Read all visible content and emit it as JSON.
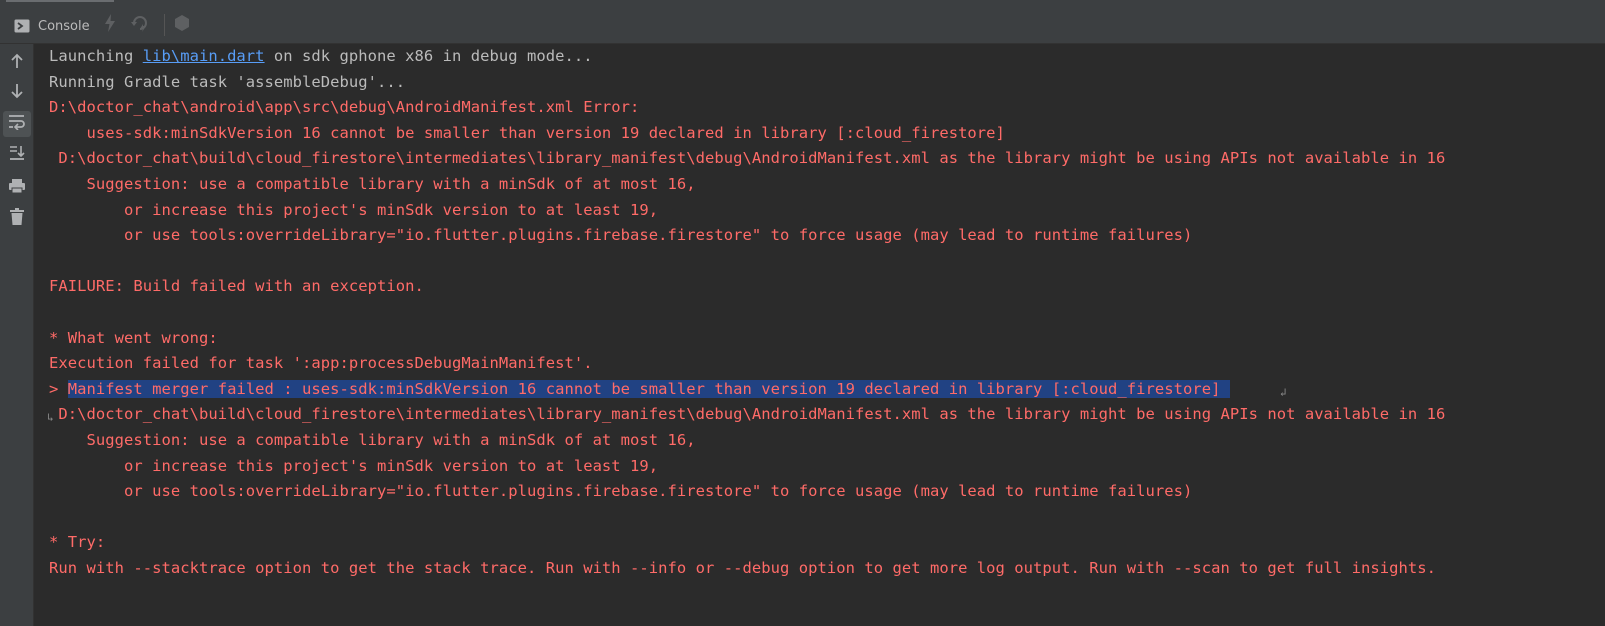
{
  "toolbar": {
    "console_label": "Console",
    "icons": [
      "console-icon",
      "lightning-icon",
      "hot-restart-icon",
      "debug-icon"
    ]
  },
  "gutter": {
    "icons": [
      "arrow-up-icon",
      "arrow-down-icon",
      "soft-wrap-icon",
      "scroll-to-end-icon",
      "print-icon",
      "trash-icon"
    ]
  },
  "console": {
    "line1": {
      "prefix": "Launching ",
      "link": "lib\\main.dart",
      "suffix": " on sdk gphone x86 in debug mode..."
    },
    "line2": "Running Gradle task 'assembleDebug'...",
    "line3": "D:\\doctor_chat\\android\\app\\src\\debug\\AndroidManifest.xml Error:",
    "line4": "    uses-sdk:minSdkVersion 16 cannot be smaller than version 19 declared in library [:cloud_firestore]",
    "line5": " D:\\doctor_chat\\build\\cloud_firestore\\intermediates\\library_manifest\\debug\\AndroidManifest.xml as the library might be using APIs not available in 16",
    "line6": "    Suggestion: use a compatible library with a minSdk of at most 16,",
    "line7": "        or increase this project's minSdk version to at least 19,",
    "line8": "        or use tools:overrideLibrary=\"io.flutter.plugins.firebase.firestore\" to force usage (may lead to runtime failures)",
    "line9": "",
    "line10": "FAILURE: Build failed with an exception.",
    "line11": "",
    "line12": "* What went wrong:",
    "line13": "Execution failed for task ':app:processDebugMainManifest'.",
    "line14": {
      "prefix": "> ",
      "selected": "Manifest merger failed : uses-sdk:minSdkVersion 16 cannot be smaller than version 19 declared in library [:cloud_firestore] "
    },
    "line15": " D:\\doctor_chat\\build\\cloud_firestore\\intermediates\\library_manifest\\debug\\AndroidManifest.xml as the library might be using APIs not available in 16",
    "line16": "    Suggestion: use a compatible library with a minSdk of at most 16,",
    "line17": "        or increase this project's minSdk version to at least 19,",
    "line18": "        or use tools:overrideLibrary=\"io.flutter.plugins.firebase.firestore\" to force usage (may lead to runtime failures)",
    "line19": "",
    "line20": "* Try:",
    "line21": "Run with --stacktrace option to get the stack trace. Run with --info or --debug option to get more log output. Run with --scan to get full insights."
  },
  "colors": {
    "background": "#2b2b2b",
    "panel": "#3c3f41",
    "error_text": "#ff6b68",
    "plain_text": "#bbbbbb",
    "link": "#589df6",
    "selection": "#214283"
  }
}
